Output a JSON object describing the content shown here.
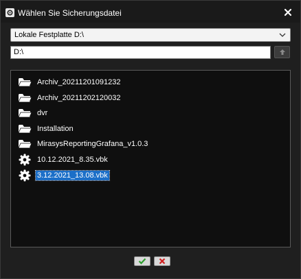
{
  "window": {
    "title": "Wählen Sie Sicherungsdatei",
    "app_icon": "gear-icon",
    "close_icon": "close-icon"
  },
  "drive_select": {
    "value": "Lokale Festplatte D:\\",
    "icon": "chevron-down-icon"
  },
  "path_input": {
    "value": "D:\\"
  },
  "up_button": {
    "icon": "arrow-up-icon"
  },
  "files": [
    {
      "name": "Archiv_20211201091232",
      "type": "folder",
      "icon": "folder-icon"
    },
    {
      "name": "Archiv_20211202120032",
      "type": "folder",
      "icon": "folder-icon"
    },
    {
      "name": "dvr",
      "type": "folder",
      "icon": "folder-icon"
    },
    {
      "name": "Installation",
      "type": "folder",
      "icon": "folder-icon"
    },
    {
      "name": "MirasysReportingGrafana_v1.0.3",
      "type": "folder",
      "icon": "folder-icon"
    },
    {
      "name": "10.12.2021_8.35.vbk",
      "type": "file",
      "icon": "gear-icon"
    },
    {
      "name": "3.12.2021_13.08.vbk",
      "type": "file",
      "icon": "gear-icon",
      "selected": true
    }
  ],
  "buttons": {
    "ok_icon": "checkmark-icon",
    "cancel_icon": "close-icon"
  },
  "colors": {
    "background": "#1f1f1f",
    "list_background": "#0f0f0f",
    "selection": "#1c6fc8",
    "ok_green": "#2e9e2e",
    "cancel_red": "#d02020"
  }
}
